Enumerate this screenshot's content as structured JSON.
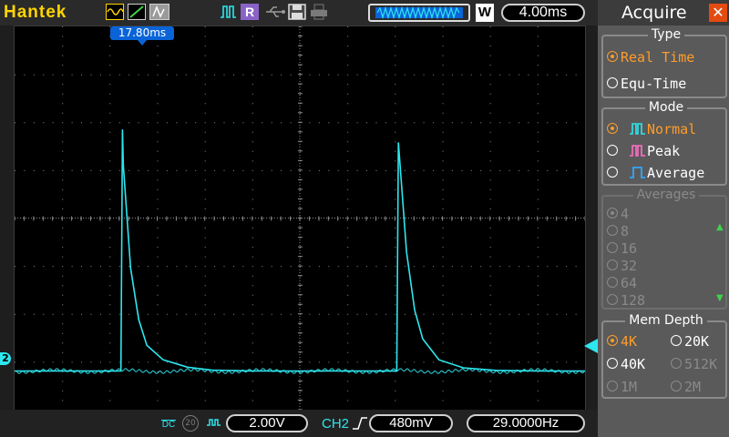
{
  "brand": "Hantek",
  "colors": {
    "trace": "#2ee6ee",
    "accent": "#ff9c2a",
    "grid": "#8c8c8c",
    "marker": "#0a64d8",
    "brand": "#ffd400"
  },
  "toolbar": {
    "run_icon": "ch-wave-icon",
    "record_label": "R",
    "save_icon": "floppy-icon",
    "print_icon": "printer-icon",
    "window_label": "W",
    "timebase": "4.00ms"
  },
  "trigger_marker": "17.80ms",
  "bottom": {
    "coupling": "DC",
    "bw_limit": "20",
    "ch1_scale": "2.00V",
    "trigger_channel": "CH2",
    "trigger_level": "480mV",
    "frequency": "29.0000Hz"
  },
  "channel_marker": "2",
  "panel": {
    "title": "Acquire",
    "type": {
      "title": "Type",
      "options": [
        "Real Time",
        "Equ-Time"
      ],
      "selected": "Real Time"
    },
    "mode": {
      "title": "Mode",
      "options": [
        "Normal",
        "Peak",
        "Average"
      ],
      "selected": "Normal"
    },
    "averages": {
      "title": "Averages",
      "options": [
        "4",
        "8",
        "16",
        "32",
        "64",
        "128"
      ],
      "enabled": false
    },
    "mem_depth": {
      "title": "Mem Depth",
      "options": [
        "4K",
        "20K",
        "40K",
        "512K",
        "1M",
        "2M"
      ],
      "selected": "4K",
      "disabled": [
        "512K",
        "1M",
        "2M"
      ]
    }
  },
  "chart_data": {
    "type": "line",
    "x": [
      -4.3,
      8.8,
      9.0,
      9.1,
      10,
      11,
      12,
      14,
      17,
      20,
      25,
      30,
      38,
      42.6,
      42.8,
      43.0,
      44,
      45,
      46,
      48,
      51,
      55,
      60,
      66
    ],
    "series": [
      {
        "values": [
          0,
          0,
          7.5,
          6.4,
          3.2,
          1.6,
          0.8,
          0.35,
          0.12,
          0.03,
          0,
          0,
          0,
          0,
          0,
          7.1,
          3.7,
          1.9,
          1.0,
          0.35,
          0.1,
          0.02,
          0,
          0
        ]
      }
    ],
    "xlabel": "",
    "ylabel": "",
    "xunit": "ms",
    "yunit": "div",
    "xlim": [
      -4.3,
      66
    ],
    "ylim": [
      -1.2,
      10.7
    ],
    "grid": true
  }
}
